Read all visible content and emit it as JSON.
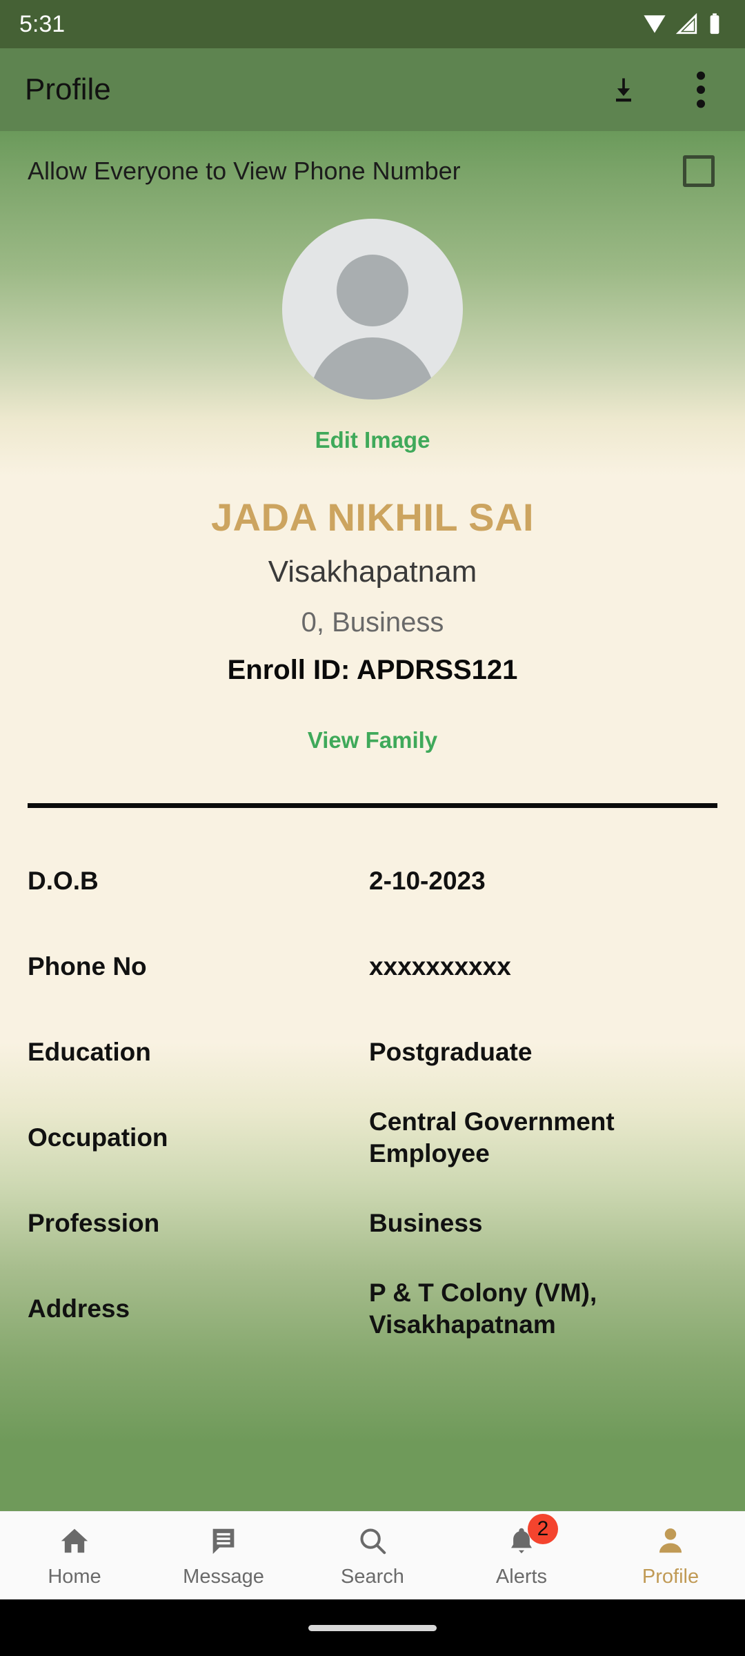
{
  "status_bar": {
    "time": "5:31",
    "icons": [
      "wifi-icon",
      "cellular-signal-icon",
      "battery-icon"
    ]
  },
  "app_bar": {
    "title": "Profile",
    "download_icon": "download-icon",
    "overflow_icon": "more-vertical-icon"
  },
  "privacy": {
    "label": "Allow Everyone to View Phone Number",
    "checked": false
  },
  "avatar": {
    "placeholder_icon": "person-avatar-icon",
    "edit_label": "Edit Image"
  },
  "profile": {
    "name": "JADA NIKHIL SAI",
    "city": "Visakhapatnam",
    "sub": "0, Business",
    "enroll": "Enroll ID: APDRSS121",
    "view_family_label": "View Family"
  },
  "details": [
    {
      "key": "D.O.B",
      "value": "2-10-2023"
    },
    {
      "key": "Phone No",
      "value": "xxxxxxxxxx"
    },
    {
      "key": "Education",
      "value": "Postgraduate"
    },
    {
      "key": "Occupation",
      "value": "Central Government Employee"
    },
    {
      "key": "Profession",
      "value": "Business"
    },
    {
      "key": "Address",
      "value": "P & T Colony (VM), Visakhapatnam"
    }
  ],
  "bottom_nav": [
    {
      "label": "Home",
      "icon": "home-icon",
      "active": false,
      "badge": null
    },
    {
      "label": "Message",
      "icon": "message-icon",
      "active": false,
      "badge": null
    },
    {
      "label": "Search",
      "icon": "search-icon",
      "active": false,
      "badge": null
    },
    {
      "label": "Alerts",
      "icon": "bell-icon",
      "active": false,
      "badge": "2"
    },
    {
      "label": "Profile",
      "icon": "person-icon",
      "active": true,
      "badge": null
    }
  ],
  "colors": {
    "status_bar_bg": "#456135",
    "app_bar_bg": "#5e8450",
    "gradient_green": "#6b9a5b",
    "gradient_cream": "#f9f2e2",
    "accent_gold": "#cca45f",
    "link_green": "#3fa95a",
    "badge_red": "#f4442e",
    "nav_bg": "#fafafa"
  }
}
